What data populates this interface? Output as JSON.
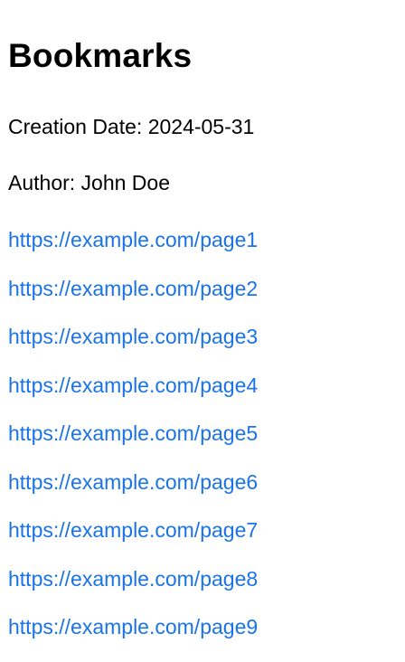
{
  "page": {
    "title": "Bookmarks",
    "creation_date": "Creation Date: 2024-05-31",
    "author": "Author: John Doe"
  },
  "bookmarks": [
    {
      "url": "https://example.com/page1"
    },
    {
      "url": "https://example.com/page2"
    },
    {
      "url": "https://example.com/page3"
    },
    {
      "url": "https://example.com/page4"
    },
    {
      "url": "https://example.com/page5"
    },
    {
      "url": "https://example.com/page6"
    },
    {
      "url": "https://example.com/page7"
    },
    {
      "url": "https://example.com/page8"
    },
    {
      "url": "https://example.com/page9"
    }
  ],
  "colors": {
    "link": "#1a73e8",
    "text": "#000000",
    "background": "#ffffff"
  }
}
